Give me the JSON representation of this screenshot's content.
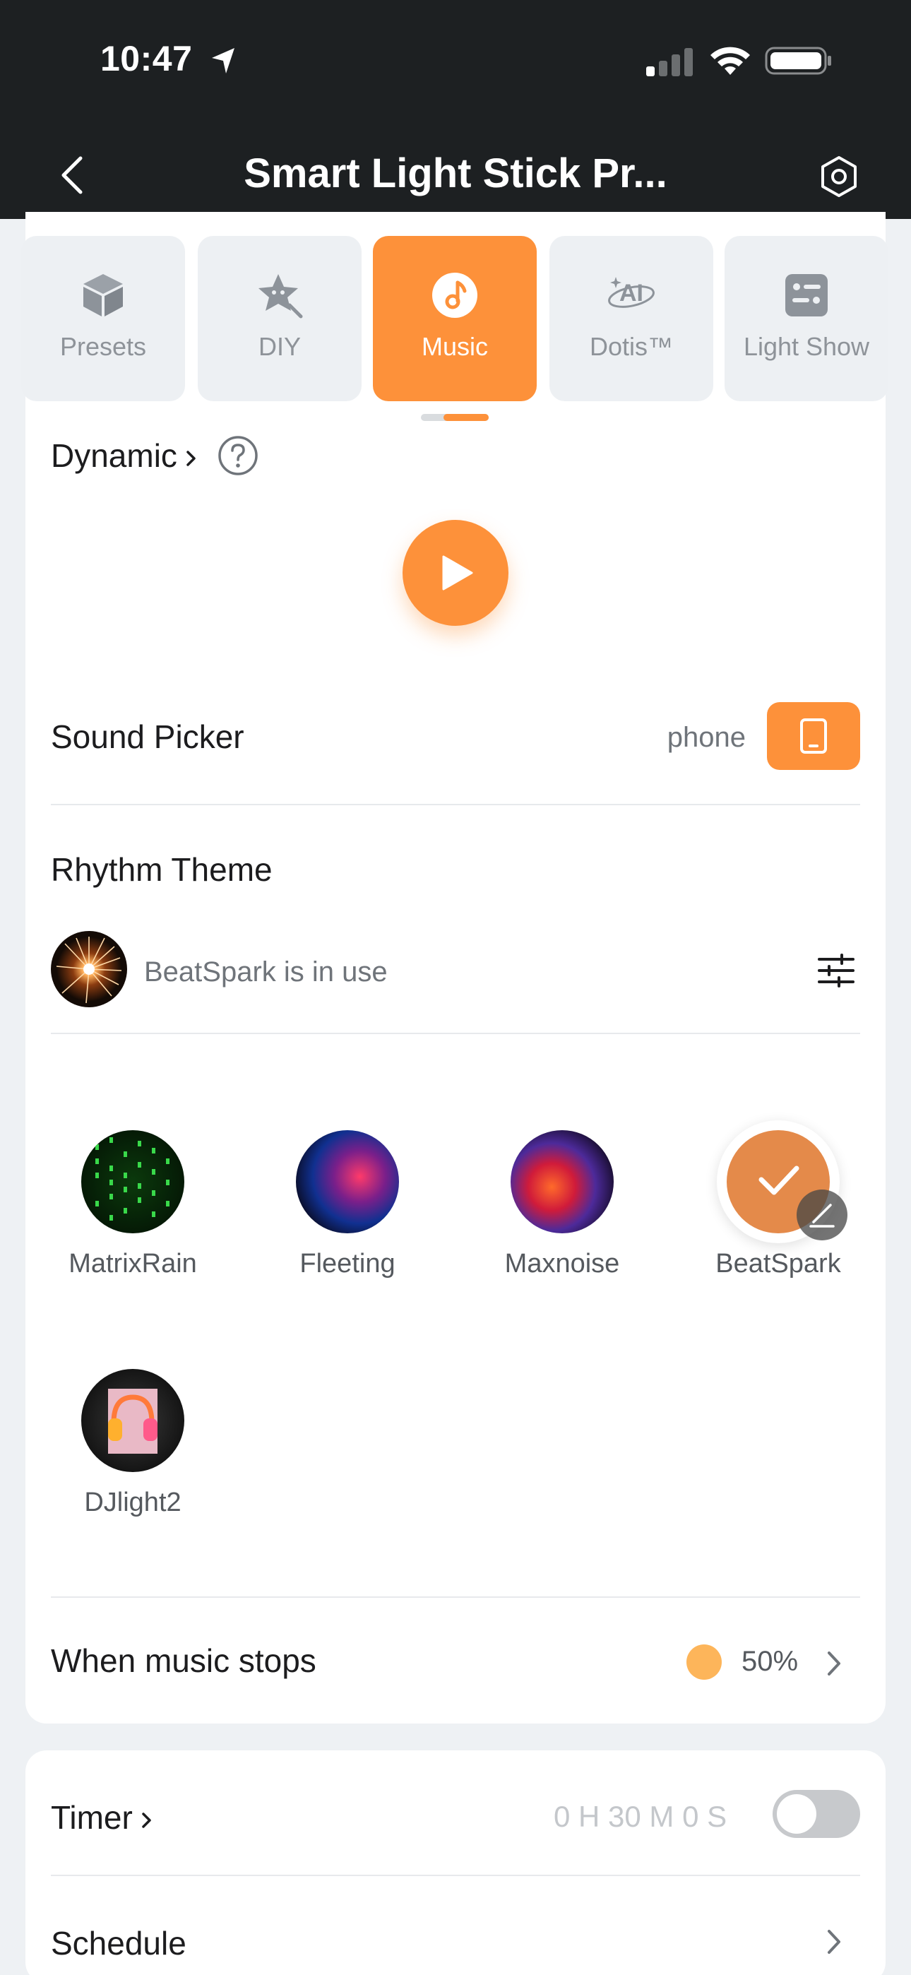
{
  "status_bar": {
    "time": "10:47"
  },
  "header": {
    "title": "Smart Light Stick Pr..."
  },
  "tabs": [
    {
      "label": "Presets"
    },
    {
      "label": "DIY"
    },
    {
      "label": "Music"
    },
    {
      "label": "Dotis™"
    },
    {
      "label": "Light Show"
    }
  ],
  "active_tab": "Music",
  "mode": {
    "label": "Dynamic"
  },
  "sound_picker": {
    "label": "Sound Picker",
    "source": "phone"
  },
  "rhythm_theme": {
    "label": "Rhythm Theme",
    "in_use_text": "BeatSpark is in use",
    "effects": [
      {
        "name": "MatrixRain"
      },
      {
        "name": "Fleeting"
      },
      {
        "name": "Maxnoise"
      },
      {
        "name": "BeatSpark"
      },
      {
        "name": "DJlight2"
      }
    ],
    "selected": "BeatSpark"
  },
  "music_stops": {
    "label": "When music stops",
    "value": "50%"
  },
  "timer": {
    "label": "Timer",
    "value": "0 H 30 M 0 S",
    "enabled": false
  },
  "schedule": {
    "label": "Schedule"
  },
  "colors": {
    "accent": "#fd913a",
    "header_bg": "#1d2022",
    "page_bg": "#eef1f4"
  }
}
